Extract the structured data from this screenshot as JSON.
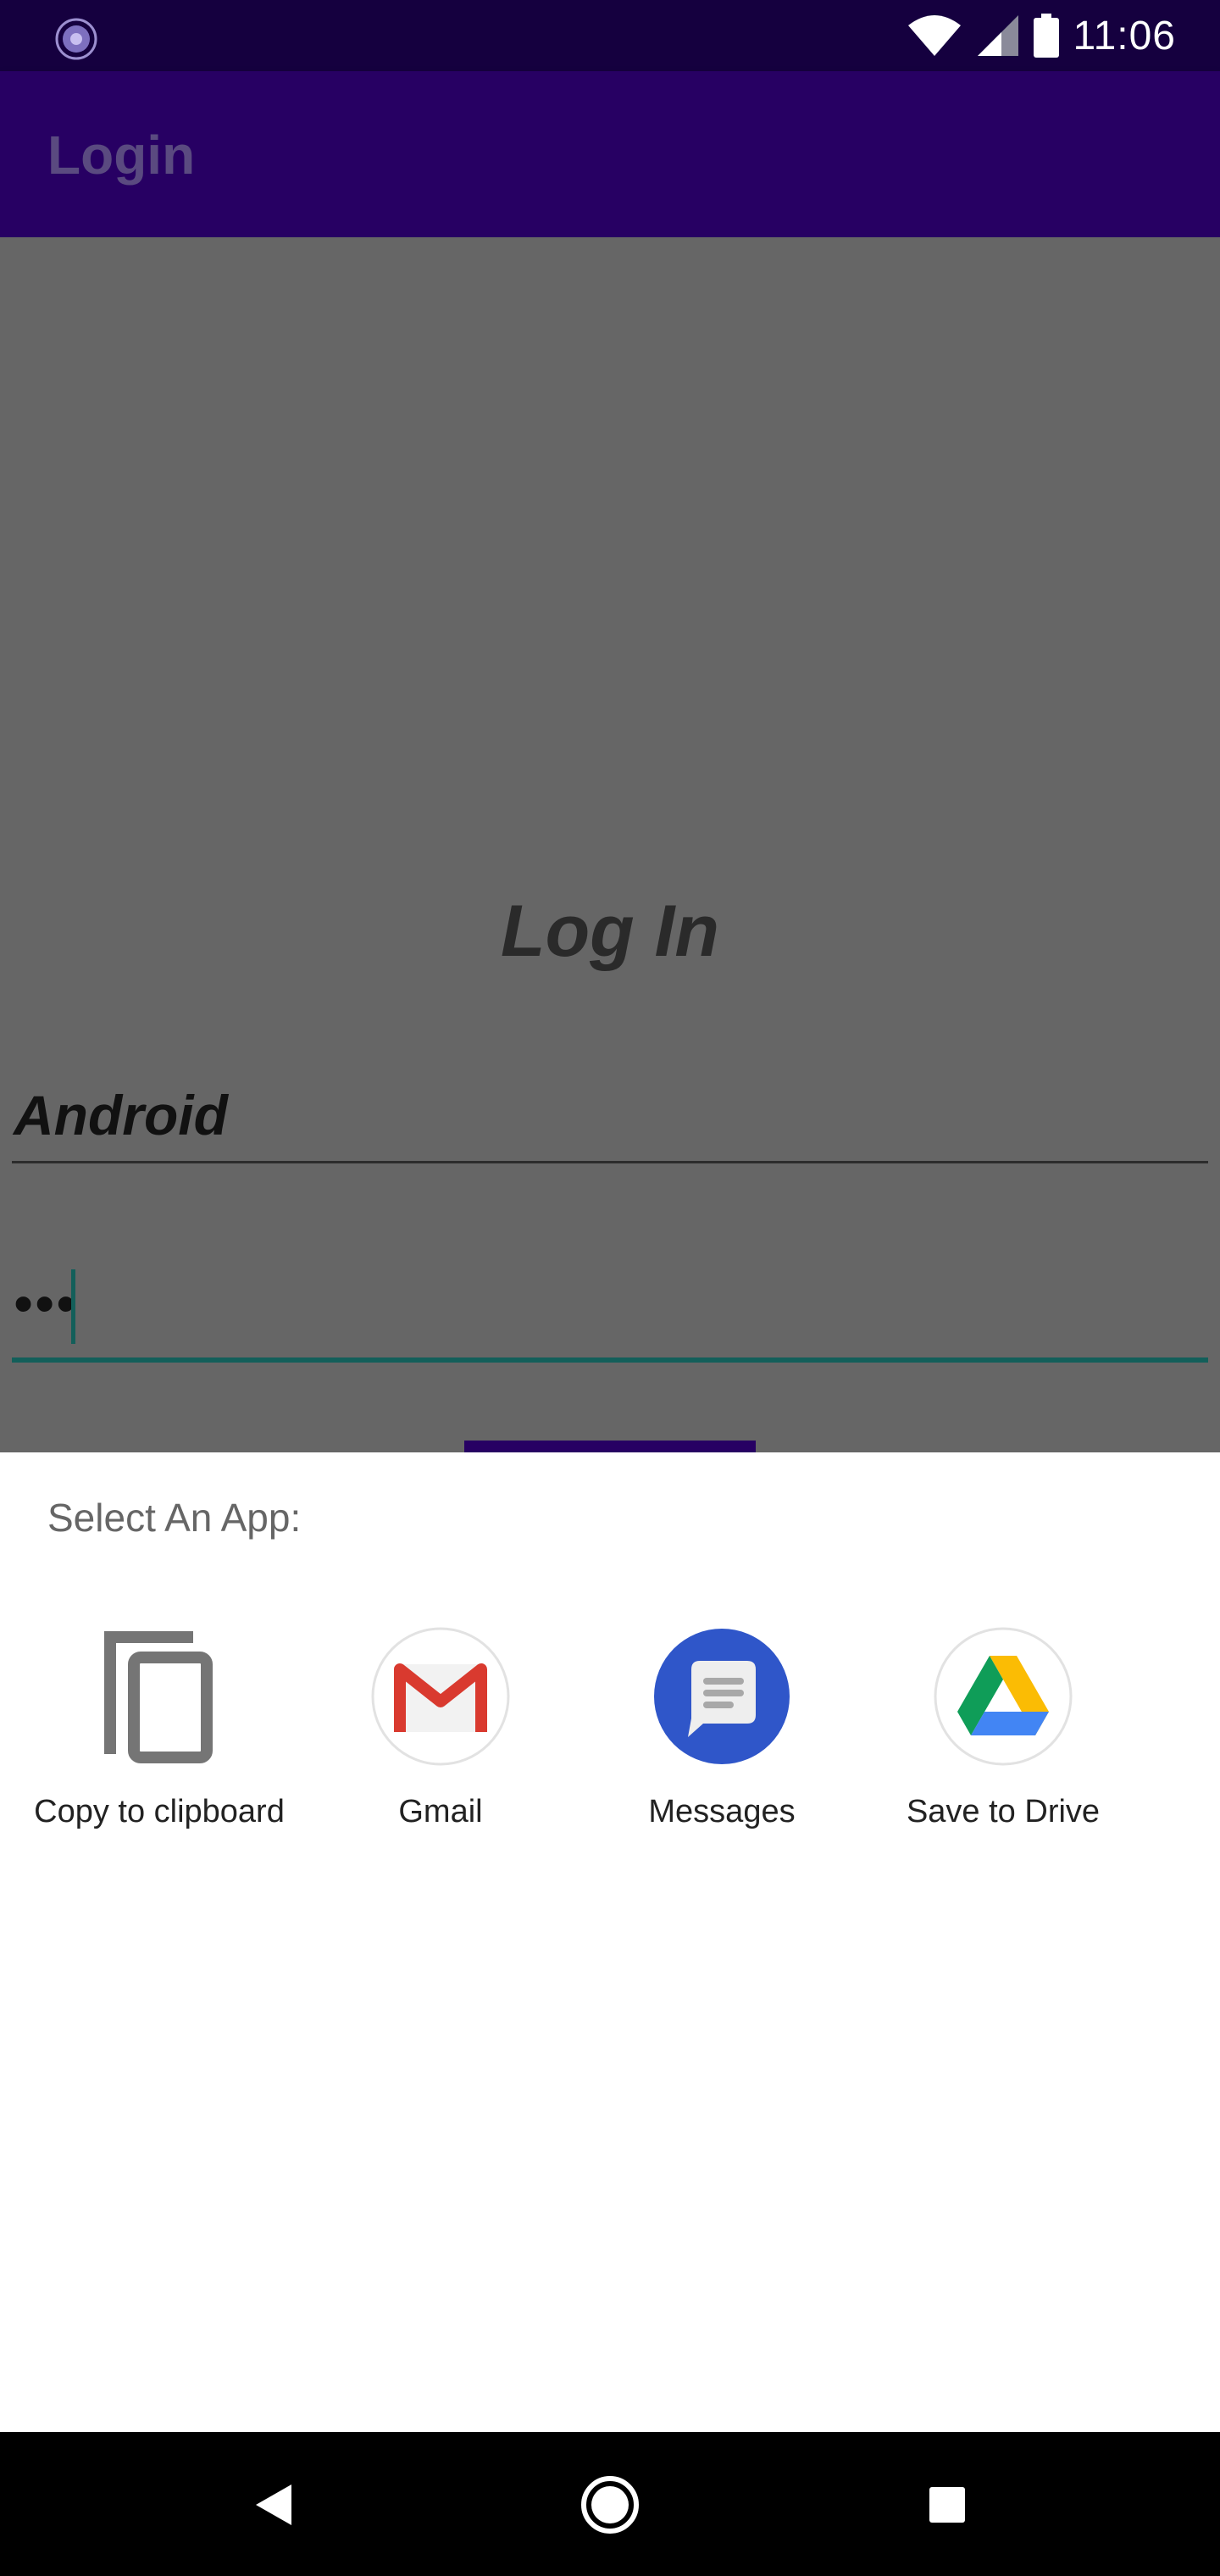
{
  "status_bar": {
    "time": "11:06",
    "app_icon": "app-status-icon",
    "wifi_icon": "wifi-icon",
    "signal_icon": "cell-signal-icon",
    "battery_icon": "battery-icon"
  },
  "app_bar": {
    "title": "Login"
  },
  "login": {
    "heading": "Log In",
    "username_value": "Android",
    "password_value": "•••"
  },
  "share_sheet": {
    "title": "Select An App:",
    "targets": [
      {
        "label": "Copy to clipboard",
        "icon": "copy-icon"
      },
      {
        "label": "Gmail",
        "icon": "gmail-icon"
      },
      {
        "label": "Messages",
        "icon": "messages-icon"
      },
      {
        "label": "Save to Drive",
        "icon": "drive-icon"
      }
    ]
  },
  "nav_bar": {
    "back_icon": "back-icon",
    "home_icon": "home-icon",
    "recents_icon": "recents-icon"
  },
  "colors": {
    "status_bar": "#15003f",
    "app_bar": "#270063",
    "scrim": "#666666",
    "accent": "#135f5a"
  }
}
